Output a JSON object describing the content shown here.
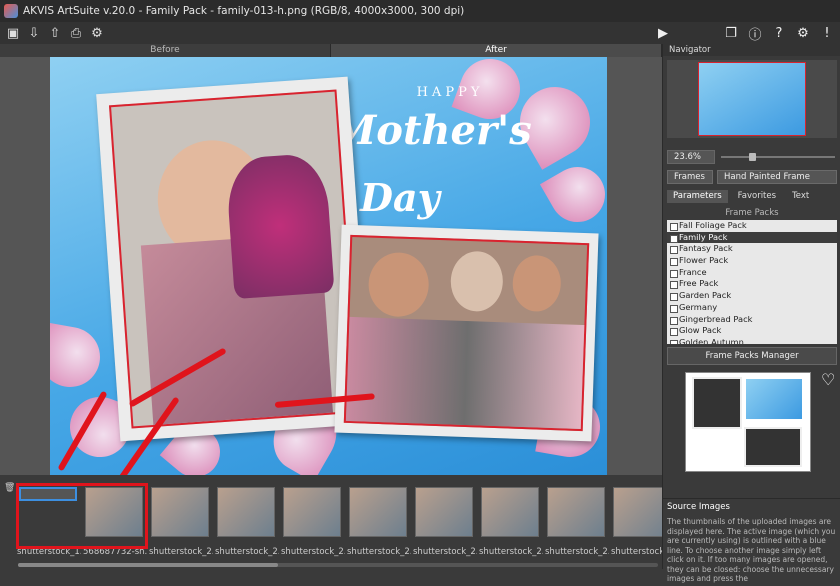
{
  "window": {
    "title": "AKVIS ArtSuite v.20.0 - Family Pack - family-013-h.png (RGB/8, 4000x3000, 300 dpi)"
  },
  "toolbar": {
    "left_icons": [
      "open-icon",
      "save-icon",
      "export-icon",
      "print-icon",
      "share-icon"
    ],
    "right_icons": [
      "play-icon",
      "windows-icon",
      "info-icon",
      "help-icon",
      "settings-icon",
      "alert-icon"
    ]
  },
  "view_tabs": [
    "Before",
    "After"
  ],
  "artwork": {
    "happy": "HAPPY",
    "mothers": "Mother's",
    "day": "Day"
  },
  "filmstrip": {
    "thumbs": [
      {
        "label": "shutterstock_1..."
      },
      {
        "label": "568687732-sh..."
      },
      {
        "label": "shutterstock_2..."
      },
      {
        "label": "shutterstock_2..."
      },
      {
        "label": "shutterstock_2..."
      },
      {
        "label": "shutterstock_2..."
      },
      {
        "label": "shutterstock_2..."
      },
      {
        "label": "shutterstock_2..."
      },
      {
        "label": "shutterstock_2..."
      },
      {
        "label": "shutterstock_2..."
      }
    ]
  },
  "sidebar": {
    "navigator_label": "Navigator",
    "zoom": "23.6%",
    "category": "Frames",
    "frame_type": "Hand Painted Frame",
    "tabs": [
      "Parameters",
      "Favorites",
      "Text"
    ],
    "list_title": "Frame Packs",
    "packs": [
      "Fall Foliage Pack",
      "Family Pack",
      "Fantasy Pack",
      "Flower Pack",
      "France",
      "Free Pack",
      "Garden Pack",
      "Germany",
      "Gingerbread Pack",
      "Glow Pack",
      "Golden Autumn"
    ],
    "selected_pack": "Family Pack",
    "manager_button": "Frame Packs Manager",
    "source_title": "Source Images",
    "source_text": "The thumbnails of the uploaded images are displayed here. The active image (which you are currently using) is outlined with a blue line. To choose another image simply left click on it. If too many images are opened, they can be closed: choose the unnecessary images and press the"
  },
  "colors": {
    "accent": "#3d8fe0",
    "frame_red": "#d9232f",
    "arrow_red": "#e0141c"
  }
}
